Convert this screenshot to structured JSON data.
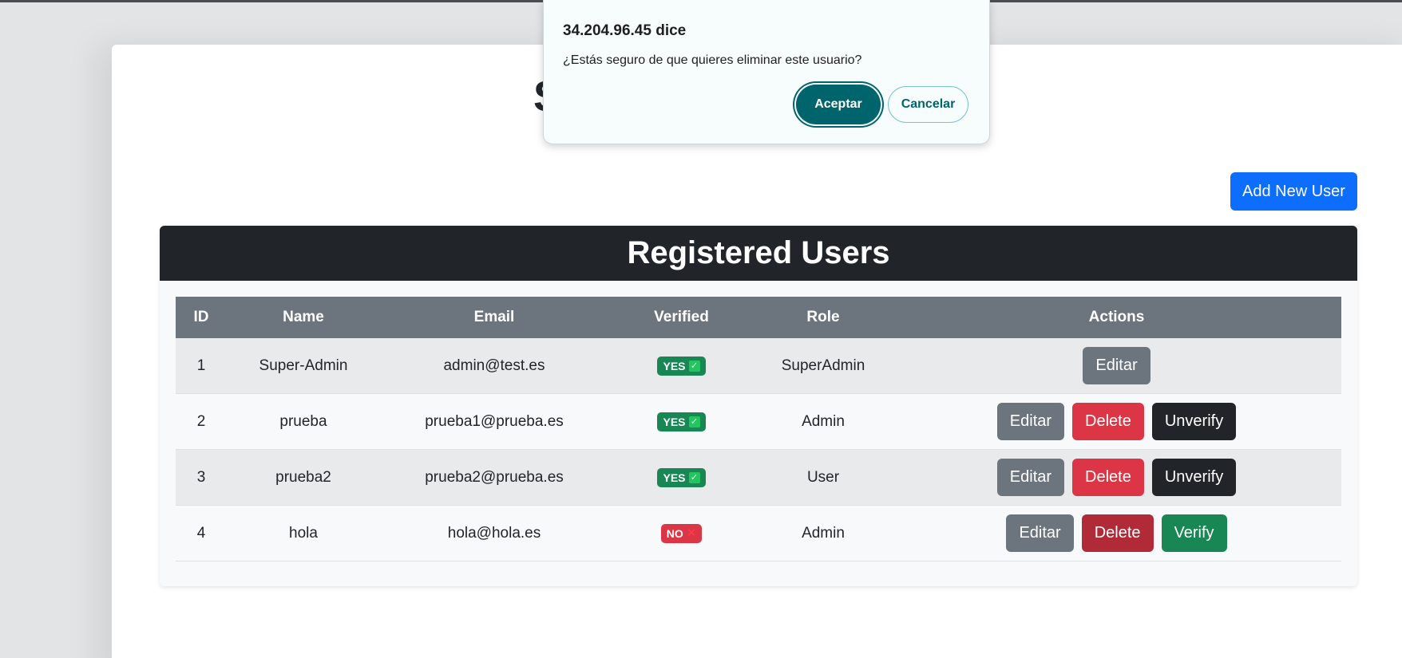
{
  "page": {
    "title_fragment": "S",
    "add_user_label": "Add New User"
  },
  "users_card": {
    "title": "Registered Users"
  },
  "table": {
    "columns": [
      "ID",
      "Name",
      "Email",
      "Verified",
      "Role",
      "Actions"
    ],
    "rows": [
      {
        "id": "1",
        "name": "Super-Admin",
        "email": "admin@test.es",
        "verified": "YES",
        "role": "SuperAdmin",
        "actions": [
          "Editar"
        ]
      },
      {
        "id": "2",
        "name": "prueba",
        "email": "prueba1@prueba.es",
        "verified": "YES",
        "role": "Admin",
        "actions": [
          "Editar",
          "Delete",
          "Unverify"
        ]
      },
      {
        "id": "3",
        "name": "prueba2",
        "email": "prueba2@prueba.es",
        "verified": "YES",
        "role": "User",
        "actions": [
          "Editar",
          "Delete",
          "Unverify"
        ]
      },
      {
        "id": "4",
        "name": "hola",
        "email": "hola@hola.es",
        "verified": "NO",
        "role": "Admin",
        "actions": [
          "Editar",
          "Delete",
          "Verify"
        ]
      }
    ]
  },
  "dialog": {
    "title": "34.204.96.45 dice",
    "message": "¿Estás seguro de que quieres eliminar este usuario?",
    "ok_label": "Aceptar",
    "cancel_label": "Cancelar"
  },
  "icons": {
    "verified_yes": "check-icon",
    "verified_no": "x-icon"
  },
  "colors": {
    "primary": "#0d6efd",
    "success": "#198754",
    "danger": "#dc3545",
    "secondary": "#6c757d",
    "dark": "#212529",
    "dialog_accent": "#00646c"
  }
}
